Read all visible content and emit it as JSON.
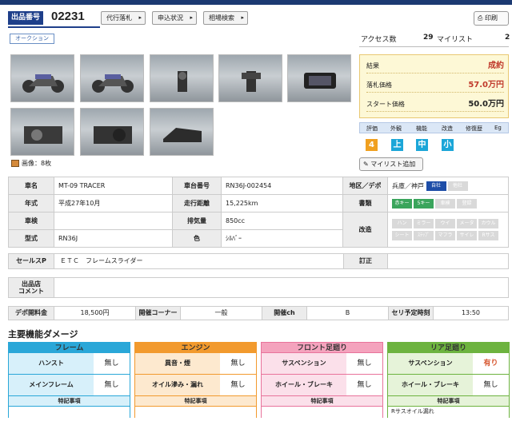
{
  "header": {
    "badge_label": "出品番号",
    "lot_number": "02231",
    "buttons": [
      "代行落札",
      "申込状況",
      "相場検索"
    ],
    "print_label": "印刷",
    "auction_tag": "オークション"
  },
  "stats": {
    "access_label": "アクセス数",
    "access_value": "29",
    "mylist_label": "マイリスト",
    "mylist_value": "2"
  },
  "price": {
    "result_label": "結果",
    "result_value": "成約",
    "sold_label": "落札価格",
    "sold_value": "57.0万円",
    "start_label": "スタート価格",
    "start_value": "50.0万円"
  },
  "evaluation": {
    "headers": [
      "評価",
      "外観",
      "機能",
      "改造",
      "修復歴",
      "Eg"
    ],
    "values": [
      "4",
      "上",
      "中",
      "小"
    ],
    "colors": [
      "#f0a020",
      "#1ba6d8",
      "#1ba6d8",
      "#1ba6d8"
    ]
  },
  "image_count": "画像：8枚",
  "mylist_add": "マイリスト追加",
  "spec": {
    "name_label": "車名",
    "name": "MT-09 TRACER",
    "frame_label": "車台番号",
    "frame": "RN36J-002454",
    "region_label": "地区／デポ",
    "region": "兵庫／神戸",
    "region_chips": [
      "自社",
      "他社"
    ],
    "year_label": "年式",
    "year": "平成27年10月",
    "mileage_label": "走行距離",
    "mileage": "15,225km",
    "docs_label": "書類",
    "docs_chips": [
      "赤キー",
      "5キー",
      "車検",
      "登録"
    ],
    "inspection_label": "車検",
    "inspection": "",
    "displacement_label": "排気量",
    "displacement": "850cc",
    "mod_label": "改造",
    "mod_chips_row1": [
      "ハン",
      "ミラー",
      "ウイ",
      "メータ",
      "カウル"
    ],
    "mod_chips_row2": [
      "シート",
      "ｽﾃｯﾌﾟ",
      "マフラ",
      "サイレ",
      "Rサス"
    ],
    "model_label": "型式",
    "model": "RN36J",
    "color_label": "色",
    "color": "ｼﾙﾊﾞｰ"
  },
  "sales": {
    "label": "セールスP",
    "value": "ＥＴＣ　フレームスライダー",
    "correction_label": "訂正",
    "correction": ""
  },
  "comment": {
    "label1": "出品店",
    "label2": "コメント",
    "value": ""
  },
  "fees": {
    "depot_label": "デポ開料金",
    "depot": "18,500円",
    "corner_label": "開催コーナー",
    "corner": "一般",
    "ch_label": "開催ch",
    "ch": "B",
    "time_label": "セリ予定時刻",
    "time": "13:50"
  },
  "damage": {
    "title": "主要機能ダメージ",
    "sections": [
      {
        "title": "フレーム",
        "rows": [
          {
            "k": "ハンスト",
            "v": "無し"
          },
          {
            "k": "メインフレーム",
            "v": "無し"
          }
        ],
        "note": "特記事項",
        "memo": ""
      },
      {
        "title": "エンジン",
        "rows": [
          {
            "k": "異音・煙",
            "v": "無し"
          },
          {
            "k": "オイル滲み・漏れ",
            "v": "無し"
          }
        ],
        "note": "特記事項",
        "memo": ""
      },
      {
        "title": "フロント足廻り",
        "rows": [
          {
            "k": "サスペンション",
            "v": "無し"
          },
          {
            "k": "ホイール・ブレーキ",
            "v": "無し"
          }
        ],
        "note": "特記事項",
        "memo": ""
      },
      {
        "title": "リア足廻り",
        "rows": [
          {
            "k": "サスペンション",
            "v": "有り"
          },
          {
            "k": "ホイール・ブレーキ",
            "v": "無し"
          }
        ],
        "note": "特記事項",
        "memo": "Rサスオイル漏れ"
      }
    ],
    "colors": [
      "#2aa7d8",
      "#f29a2e",
      "#e8739b",
      "#6db33f"
    ],
    "light_colors": [
      "#d7f0fa",
      "#fde9cf",
      "#fbe0ea",
      "#e6f3d9"
    ],
    "alert_color": "#d6542c"
  }
}
